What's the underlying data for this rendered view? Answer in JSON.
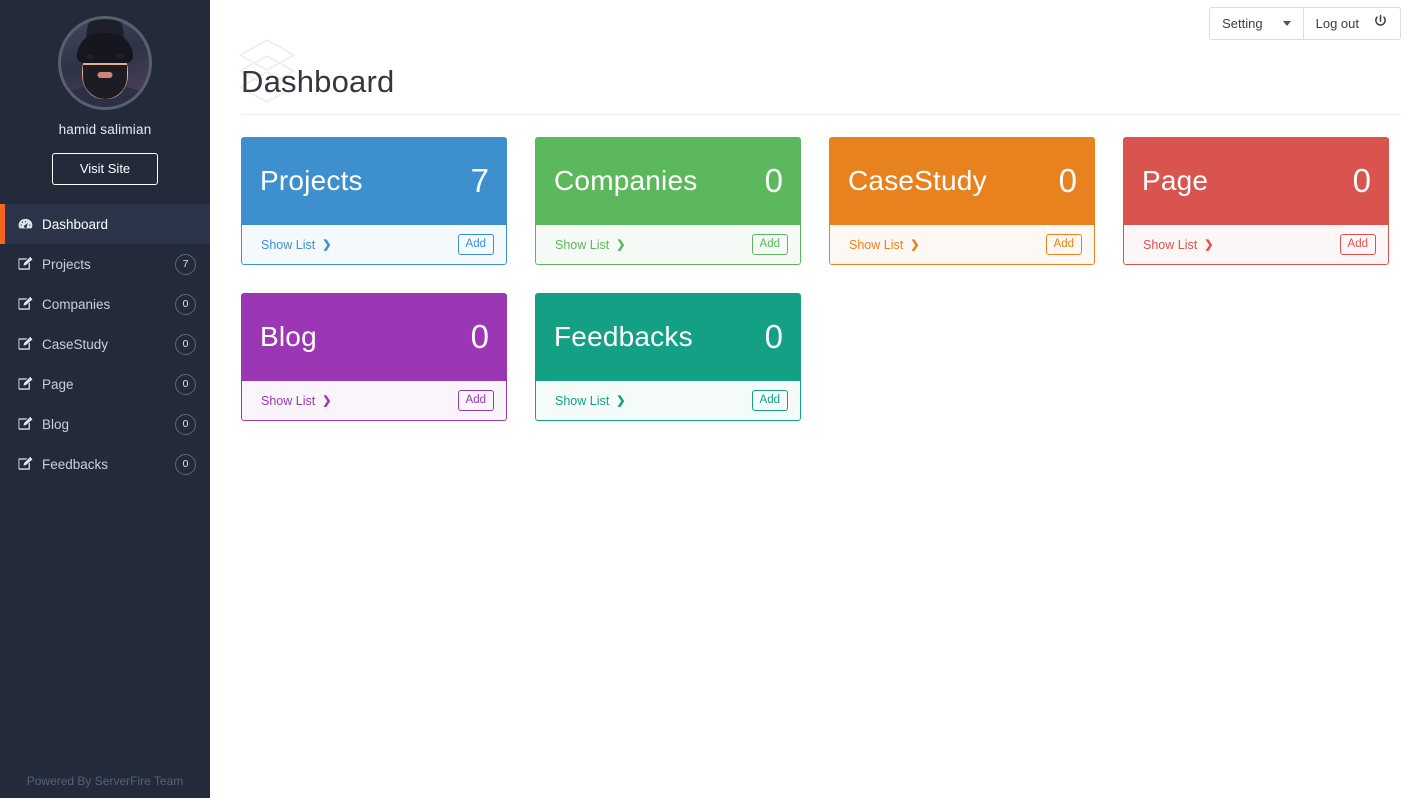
{
  "sidebar": {
    "user_name": "hamid salimian",
    "visit_button": "Visit Site",
    "powered_by": "Powered By ServerFire Team",
    "items": [
      {
        "label": "Dashboard",
        "icon": "dashboard-icon",
        "badge": null,
        "active": true
      },
      {
        "label": "Projects",
        "icon": "edit-icon",
        "badge": "7",
        "active": false
      },
      {
        "label": "Companies",
        "icon": "edit-icon",
        "badge": "0",
        "active": false
      },
      {
        "label": "CaseStudy",
        "icon": "edit-icon",
        "badge": "0",
        "active": false
      },
      {
        "label": "Page",
        "icon": "edit-icon",
        "badge": "0",
        "active": false
      },
      {
        "label": "Blog",
        "icon": "edit-icon",
        "badge": "0",
        "active": false
      },
      {
        "label": "Feedbacks",
        "icon": "edit-icon",
        "badge": "0",
        "active": false
      }
    ],
    "background": "#232b3b",
    "active_marker_color": "#f26522"
  },
  "topbar": {
    "setting_label": "Setting",
    "setting_icon": "chevron-down-icon",
    "logout_label": "Log out",
    "logout_icon": "power-icon"
  },
  "page": {
    "title": "Dashboard",
    "watermark_icon": "layers-stack-icon"
  },
  "cards": [
    {
      "title": "Projects",
      "count": "7",
      "color": "#3e8fcd",
      "tint": "#f4f9fd",
      "show_list": "Show List",
      "add": "Add",
      "chevron": "❯"
    },
    {
      "title": "Companies",
      "count": "0",
      "color": "#5cb85c",
      "tint": "#f6faf6",
      "show_list": "Show List",
      "add": "Add",
      "chevron": "❯"
    },
    {
      "title": "CaseStudy",
      "count": "0",
      "color": "#e8821e",
      "tint": "#fdf8f3",
      "show_list": "Show List",
      "add": "Add",
      "chevron": "❯"
    },
    {
      "title": "Page",
      "count": "0",
      "color": "#d9534f",
      "tint": "#fdf6f6",
      "show_list": "Show List",
      "add": "Add",
      "chevron": "❯"
    },
    {
      "title": "Blog",
      "count": "0",
      "color": "#9b36b5",
      "tint": "#faf5fb",
      "show_list": "Show List",
      "add": "Add",
      "chevron": "❯"
    },
    {
      "title": "Feedbacks",
      "count": "0",
      "color": "#14a085",
      "tint": "#f4fbf9",
      "show_list": "Show List",
      "add": "Add",
      "chevron": "❯"
    }
  ]
}
